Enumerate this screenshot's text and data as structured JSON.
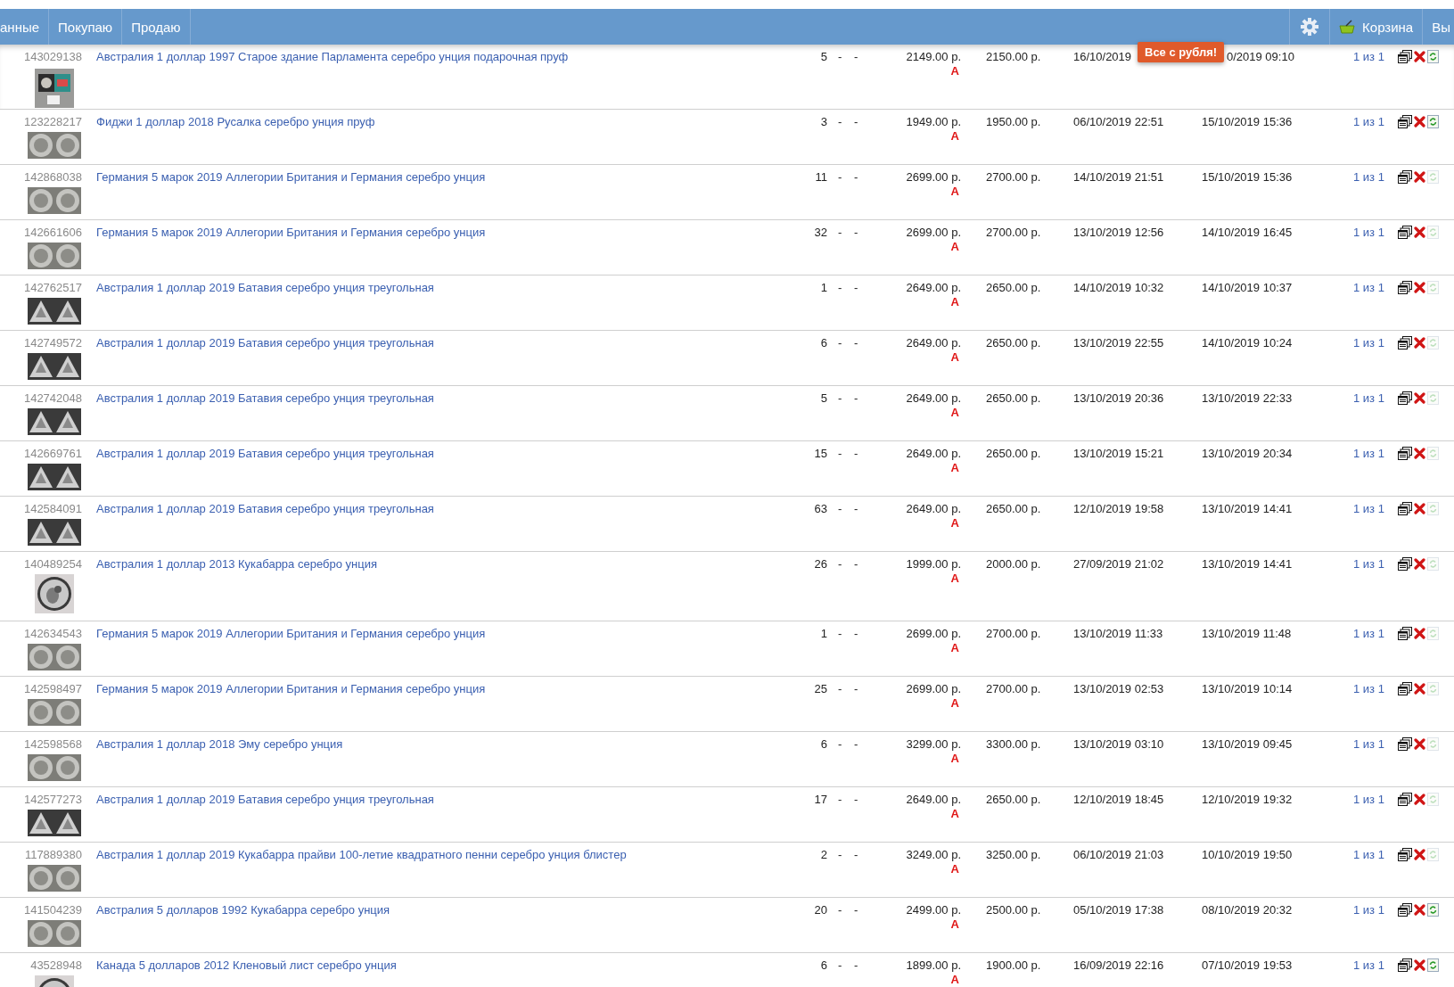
{
  "nav": {
    "left_items": [
      "анные",
      "Покупаю",
      "Продаю"
    ],
    "cart_label": "Корзина",
    "last_item": "Вы"
  },
  "badge": "Все с рубля!",
  "rows": [
    {
      "id": "143029138",
      "title": "Австралия 1 доллар 1997 Старое здание Парламента серебро унция подарочная пруф",
      "qty": "5",
      "dash_1": "-",
      "dash_2": "-",
      "price": "2149.00 р.",
      "mark": "А",
      "buyout": "2150.00 р.",
      "start": "16/10/2019",
      "end": "0/2019 09:10",
      "count": "1 из 1",
      "refresh_enabled": true
    },
    {
      "id": "123228217",
      "title": "Фиджи 1 доллар 2018 Русалка серебро унция пруф",
      "qty": "3",
      "dash_1": "-",
      "dash_2": "-",
      "price": "1949.00 р.",
      "mark": "А",
      "buyout": "1950.00 р.",
      "start": "06/10/2019 22:51",
      "end": "15/10/2019 15:36",
      "count": "1 из 1",
      "refresh_enabled": true
    },
    {
      "id": "142868038",
      "title": "Германия 5 марок 2019 Аллегории Британия и Германия серебро унция",
      "qty": "11",
      "dash_1": "-",
      "dash_2": "-",
      "price": "2699.00 р.",
      "mark": "А",
      "buyout": "2700.00 р.",
      "start": "14/10/2019 21:51",
      "end": "15/10/2019 15:36",
      "count": "1 из 1",
      "refresh_enabled": false
    },
    {
      "id": "142661606",
      "title": "Германия 5 марок 2019 Аллегории Британия и Германия серебро унция",
      "qty": "32",
      "dash_1": "-",
      "dash_2": "-",
      "price": "2699.00 р.",
      "mark": "А",
      "buyout": "2700.00 р.",
      "start": "13/10/2019 12:56",
      "end": "14/10/2019 16:45",
      "count": "1 из 1",
      "refresh_enabled": false
    },
    {
      "id": "142762517",
      "title": "Австралия 1 доллар 2019 Батавия серебро унция треугольная",
      "qty": "1",
      "dash_1": "-",
      "dash_2": "-",
      "price": "2649.00 р.",
      "mark": "А",
      "buyout": "2650.00 р.",
      "start": "14/10/2019 10:32",
      "end": "14/10/2019 10:37",
      "count": "1 из 1",
      "refresh_enabled": false
    },
    {
      "id": "142749572",
      "title": "Австралия 1 доллар 2019 Батавия серебро унция треугольная",
      "qty": "6",
      "dash_1": "-",
      "dash_2": "-",
      "price": "2649.00 р.",
      "mark": "А",
      "buyout": "2650.00 р.",
      "start": "13/10/2019 22:55",
      "end": "14/10/2019 10:24",
      "count": "1 из 1",
      "refresh_enabled": false
    },
    {
      "id": "142742048",
      "title": "Австралия 1 доллар 2019 Батавия серебро унция треугольная",
      "qty": "5",
      "dash_1": "-",
      "dash_2": "-",
      "price": "2649.00 р.",
      "mark": "А",
      "buyout": "2650.00 р.",
      "start": "13/10/2019 20:36",
      "end": "13/10/2019 22:33",
      "count": "1 из 1",
      "refresh_enabled": false
    },
    {
      "id": "142669761",
      "title": "Австралия 1 доллар 2019 Батавия серебро унция треугольная",
      "qty": "15",
      "dash_1": "-",
      "dash_2": "-",
      "price": "2649.00 р.",
      "mark": "А",
      "buyout": "2650.00 р.",
      "start": "13/10/2019 15:21",
      "end": "13/10/2019 20:34",
      "count": "1 из 1",
      "refresh_enabled": false
    },
    {
      "id": "142584091",
      "title": "Австралия 1 доллар 2019 Батавия серебро унция треугольная",
      "qty": "63",
      "dash_1": "-",
      "dash_2": "-",
      "price": "2649.00 р.",
      "mark": "А",
      "buyout": "2650.00 р.",
      "start": "12/10/2019 19:58",
      "end": "13/10/2019 14:41",
      "count": "1 из 1",
      "refresh_enabled": false
    },
    {
      "id": "140489254",
      "title": "Австралия 1 доллар 2013 Кукабарра серебро унция",
      "qty": "26",
      "dash_1": "-",
      "dash_2": "-",
      "price": "1999.00 р.",
      "mark": "А",
      "buyout": "2000.00 р.",
      "start": "27/09/2019 21:02",
      "end": "13/10/2019 14:41",
      "count": "1 из 1",
      "refresh_enabled": false
    },
    {
      "id": "142634543",
      "title": "Германия 5 марок 2019 Аллегории Британия и Германия серебро унция",
      "qty": "1",
      "dash_1": "-",
      "dash_2": "-",
      "price": "2699.00 р.",
      "mark": "А",
      "buyout": "2700.00 р.",
      "start": "13/10/2019 11:33",
      "end": "13/10/2019 11:48",
      "count": "1 из 1",
      "refresh_enabled": false
    },
    {
      "id": "142598497",
      "title": "Германия 5 марок 2019 Аллегории Британия и Германия серебро унция",
      "qty": "25",
      "dash_1": "-",
      "dash_2": "-",
      "price": "2699.00 р.",
      "mark": "А",
      "buyout": "2700.00 р.",
      "start": "13/10/2019 02:53",
      "end": "13/10/2019 10:14",
      "count": "1 из 1",
      "refresh_enabled": false
    },
    {
      "id": "142598568",
      "title": "Австралия 1 доллар 2018 Эму серебро унция",
      "qty": "6",
      "dash_1": "-",
      "dash_2": "-",
      "price": "3299.00 р.",
      "mark": "А",
      "buyout": "3300.00 р.",
      "start": "13/10/2019 03:10",
      "end": "13/10/2019 09:45",
      "count": "1 из 1",
      "refresh_enabled": false
    },
    {
      "id": "142577273",
      "title": "Австралия 1 доллар 2019 Батавия серебро унция треугольная",
      "qty": "17",
      "dash_1": "-",
      "dash_2": "-",
      "price": "2649.00 р.",
      "mark": "А",
      "buyout": "2650.00 р.",
      "start": "12/10/2019 18:45",
      "end": "12/10/2019 19:32",
      "count": "1 из 1",
      "refresh_enabled": false
    },
    {
      "id": "117889380",
      "title": "Австралия 1 доллар 2019 Кукабарра прайви 100-летие квадратного пенни серебро унция блистер",
      "qty": "2",
      "dash_1": "-",
      "dash_2": "-",
      "price": "3249.00 р.",
      "mark": "А",
      "buyout": "3250.00 р.",
      "start": "06/10/2019 21:03",
      "end": "10/10/2019 19:50",
      "count": "1 из 1",
      "refresh_enabled": false
    },
    {
      "id": "141504239",
      "title": "Австралия 5 долларов 1992 Кукабарра серебро унция",
      "qty": "20",
      "dash_1": "-",
      "dash_2": "-",
      "price": "2499.00 р.",
      "mark": "А",
      "buyout": "2500.00 р.",
      "start": "05/10/2019 17:38",
      "end": "08/10/2019 20:32",
      "count": "1 из 1",
      "refresh_enabled": true
    },
    {
      "id": "43528948",
      "title": "Канада 5 долларов 2012 Кленовый лист серебро унция",
      "qty": "6",
      "dash_1": "-",
      "dash_2": "-",
      "price": "1899.00 р.",
      "mark": "А",
      "buyout": "1900.00 р.",
      "start": "16/09/2019 22:16",
      "end": "07/10/2019 19:53",
      "count": "1 из 1",
      "refresh_enabled": true
    }
  ]
}
